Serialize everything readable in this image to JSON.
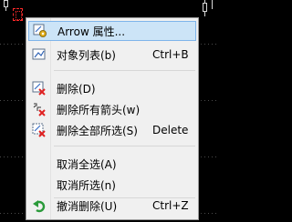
{
  "menu": {
    "items": [
      {
        "label": "Arrow 属性...",
        "shortcut": "",
        "icon": "properties-icon",
        "highlighted": true
      },
      {
        "label": "对象列表(b)",
        "shortcut": "Ctrl+B",
        "icon": "object-list-icon"
      },
      {
        "label": "删除(D)",
        "shortcut": "",
        "icon": "delete-icon"
      },
      {
        "label": "删除所有箭头(w)",
        "shortcut": "",
        "icon": "delete-all-arrows-icon"
      },
      {
        "label": "删除全部所选(S)",
        "shortcut": "Delete",
        "icon": "delete-selected-icon"
      },
      {
        "label": "取消全选(A)",
        "shortcut": "",
        "icon": ""
      },
      {
        "label": "取消所选(n)",
        "shortcut": "",
        "icon": ""
      },
      {
        "label": "撤消删除(U)",
        "shortcut": "Ctrl+Z",
        "icon": "undo-icon"
      }
    ]
  },
  "colors": {
    "chart_background": "#000000",
    "menu_background": "#f0f0f0",
    "highlight_fill": "#cce4f7",
    "highlight_border": "#7eb4ea",
    "arrow_marker": "#ff2a2a"
  }
}
